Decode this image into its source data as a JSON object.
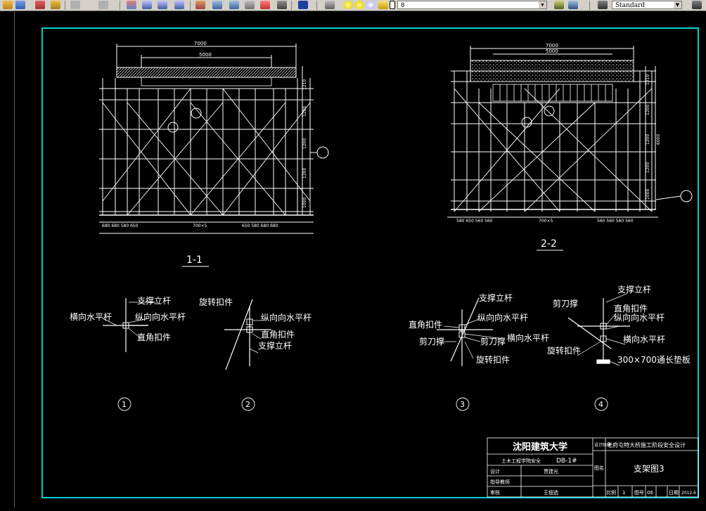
{
  "toolbar": {
    "layer_value": "0",
    "text_style_value": "Standard"
  },
  "views": {
    "view1_label": "1-1",
    "view2_label": "2-2"
  },
  "dims": {
    "v1_total": "7000",
    "v1_inner": "5000",
    "v1_bottom_left": "680  680  580  650",
    "v1_bottom_mid": "700×5",
    "v1_bottom_right": "650  580  680  680",
    "v1_right": [
      "1210",
      "1200",
      "1200",
      "1200",
      "1000"
    ],
    "v2_total": "7000",
    "v2_inner": "5000",
    "v2_bottom_left": "580  650  560  560",
    "v2_bottom_mid": "700×5",
    "v2_bottom_right": "560  560  560  560",
    "v2_right": [
      "1210",
      "1200",
      "1200",
      "1200",
      "1000"
    ],
    "v2_total_height": "6000"
  },
  "callouts": {
    "c1": "1",
    "c2": "2",
    "c3": "3",
    "c4": "4"
  },
  "details": {
    "d1": {
      "vertical_pole": "支撑立杆",
      "transverse_bar": "横向水平杆",
      "longitudinal_bar": "纵向向水平杆",
      "right_angle_clamp": "直角扣件",
      "number": "1"
    },
    "d2": {
      "swivel_clamp": "旋转扣件",
      "longitudinal_bar": "纵向向水平杆",
      "right_angle_clamp": "直角扣件",
      "vertical_pole": "支撑立杆",
      "number": "2"
    },
    "d3": {
      "vertical_pole": "支撑立杆",
      "longitudinal_bar": "纵向向水平杆",
      "right_angle_clamp": "直角扣件",
      "transverse_bar": "横向水平杆",
      "scissor_brace": "剪刀撑",
      "swivel_clamp": "旋转扣件",
      "number": "3"
    },
    "d4": {
      "vertical_pole": "支撑立杆",
      "scissor_brace": "剪刀撑",
      "right_angle_clamp": "直角扣件",
      "longitudinal_bar": "纵向向水平杆",
      "transverse_bar": "横向水平杆",
      "swivel_clamp": "旋转扣件",
      "base_plate": "300×700通长垫板",
      "number": "4"
    }
  },
  "title_block": {
    "university": "沈阳建筑大学",
    "department": "土木工程学院安全",
    "drawing_no": "DB-1#",
    "designer_label": "设计",
    "designer_value": "贾建光",
    "review_label": "指导教师",
    "check_label": "审核",
    "checker_value": "王佃选",
    "design_stage": "设计阶段",
    "project_name": "老府屯特大桥施工阶段安全设计",
    "sign_label": "图名",
    "drawing_title": "支架图3",
    "scale_label": "比例",
    "scale_value": "1",
    "sheet_label": "图号",
    "sheet_value": "06",
    "total_label": "日期",
    "date_value": "2012.6"
  }
}
